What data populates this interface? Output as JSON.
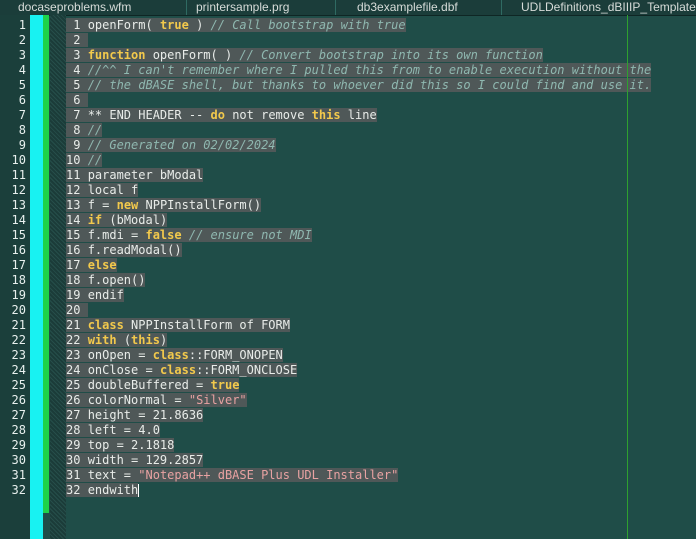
{
  "tabs": [
    {
      "label": "docaseproblems.wfm"
    },
    {
      "label": "printersample.prg"
    },
    {
      "label": "db3examplefile.dbf"
    },
    {
      "label": "UDLDefinitions_dBIIIP_Template.xml"
    }
  ],
  "gutter": {
    "line_numbers": [
      "1",
      "2",
      "3",
      "4",
      "5",
      "6",
      "7",
      "8",
      "9",
      "10",
      "11",
      "12",
      "13",
      "14",
      "15",
      "16",
      "17",
      "18",
      "19",
      "20",
      "21",
      "22",
      "23",
      "24",
      "25",
      "26",
      "27",
      "28",
      "29",
      "30",
      "31",
      "32"
    ]
  },
  "code_lines": [
    {
      "num": "1",
      "segs": [
        {
          "t": "openForm( "
        },
        {
          "t": "true",
          "c": "kw"
        },
        {
          "t": " ) "
        },
        {
          "t": "// Call bootstrap with true",
          "c": "cm"
        }
      ]
    },
    {
      "num": "2",
      "segs": [
        {
          "t": ""
        }
      ]
    },
    {
      "num": "3",
      "segs": [
        {
          "t": "function",
          "c": "kw"
        },
        {
          "t": " openForm( ) "
        },
        {
          "t": "// Convert bootstrap into its own function",
          "c": "cm"
        }
      ]
    },
    {
      "num": "4",
      "segs": [
        {
          "t": "//^^ I can't remember where I pulled this from to enable execution without the",
          "c": "cm"
        }
      ]
    },
    {
      "num": "5",
      "segs": [
        {
          "t": "// the dBASE shell, but thanks to whoever did this so I could find and use it.",
          "c": "cm"
        }
      ]
    },
    {
      "num": "6",
      "segs": [
        {
          "t": ""
        }
      ]
    },
    {
      "num": "7",
      "segs": [
        {
          "t": "** END HEADER -- "
        },
        {
          "t": "do",
          "c": "kw"
        },
        {
          "t": " not remove "
        },
        {
          "t": "this",
          "c": "kw"
        },
        {
          "t": " line"
        }
      ]
    },
    {
      "num": "8",
      "segs": [
        {
          "t": "//",
          "c": "cm"
        }
      ]
    },
    {
      "num": "9",
      "segs": [
        {
          "t": "// Generated on 02/02/2024",
          "c": "cm"
        }
      ]
    },
    {
      "num": "10",
      "segs": [
        {
          "t": "//",
          "c": "cm"
        }
      ]
    },
    {
      "num": "11",
      "segs": [
        {
          "t": "parameter bModal"
        }
      ]
    },
    {
      "num": "12",
      "segs": [
        {
          "t": "local f"
        }
      ]
    },
    {
      "num": "13",
      "segs": [
        {
          "t": "f = "
        },
        {
          "t": "new",
          "c": "kw"
        },
        {
          "t": " NPPInstallForm()"
        }
      ]
    },
    {
      "num": "14",
      "segs": [
        {
          "t": "if",
          "c": "kw"
        },
        {
          "t": " (bModal)"
        }
      ]
    },
    {
      "num": "15",
      "segs": [
        {
          "t": "f.mdi = "
        },
        {
          "t": "false",
          "c": "kw"
        },
        {
          "t": " "
        },
        {
          "t": "// ensure not MDI",
          "c": "cm"
        }
      ]
    },
    {
      "num": "16",
      "segs": [
        {
          "t": "f.readModal()"
        }
      ]
    },
    {
      "num": "17",
      "segs": [
        {
          "t": "else",
          "c": "kw"
        }
      ]
    },
    {
      "num": "18",
      "segs": [
        {
          "t": "f.open()"
        }
      ]
    },
    {
      "num": "19",
      "segs": [
        {
          "t": "endif"
        }
      ]
    },
    {
      "num": "20",
      "segs": [
        {
          "t": ""
        }
      ]
    },
    {
      "num": "21",
      "segs": [
        {
          "t": "class",
          "c": "kw"
        },
        {
          "t": " NPPInstallForm of FORM"
        }
      ]
    },
    {
      "num": "22",
      "segs": [
        {
          "t": "with",
          "c": "kw"
        },
        {
          "t": " ("
        },
        {
          "t": "this",
          "c": "kw"
        },
        {
          "t": ")"
        }
      ]
    },
    {
      "num": "23",
      "segs": [
        {
          "t": "onOpen = "
        },
        {
          "t": "class",
          "c": "kw"
        },
        {
          "t": "::FORM_ONOPEN"
        }
      ]
    },
    {
      "num": "24",
      "segs": [
        {
          "t": "onClose = "
        },
        {
          "t": "class",
          "c": "kw"
        },
        {
          "t": "::FORM_ONCLOSE"
        }
      ]
    },
    {
      "num": "25",
      "segs": [
        {
          "t": "doubleBuffered = "
        },
        {
          "t": "true",
          "c": "kw"
        }
      ]
    },
    {
      "num": "26",
      "segs": [
        {
          "t": "colorNormal = "
        },
        {
          "t": "\"Silver\"",
          "c": "st"
        }
      ]
    },
    {
      "num": "27",
      "segs": [
        {
          "t": "height = 21.8636"
        }
      ]
    },
    {
      "num": "28",
      "segs": [
        {
          "t": "left = 4.0"
        }
      ]
    },
    {
      "num": "29",
      "segs": [
        {
          "t": "top = 2.1818"
        }
      ]
    },
    {
      "num": "30",
      "segs": [
        {
          "t": "width = 129.2857"
        }
      ]
    },
    {
      "num": "31",
      "segs": [
        {
          "t": "text = "
        },
        {
          "t": "\"Notepad++ dBASE Plus UDL Installer\"",
          "c": "st"
        }
      ]
    },
    {
      "num": "32",
      "segs": [
        {
          "t": "endwith"
        }
      ]
    }
  ],
  "colors": {
    "background": "#1f4d48",
    "keyword": "#f2c94c",
    "comment": "#8fb8b0",
    "string": "#e8a2a2",
    "marker_cyan": "#18f2f2",
    "marker_green": "#1ed24a"
  }
}
